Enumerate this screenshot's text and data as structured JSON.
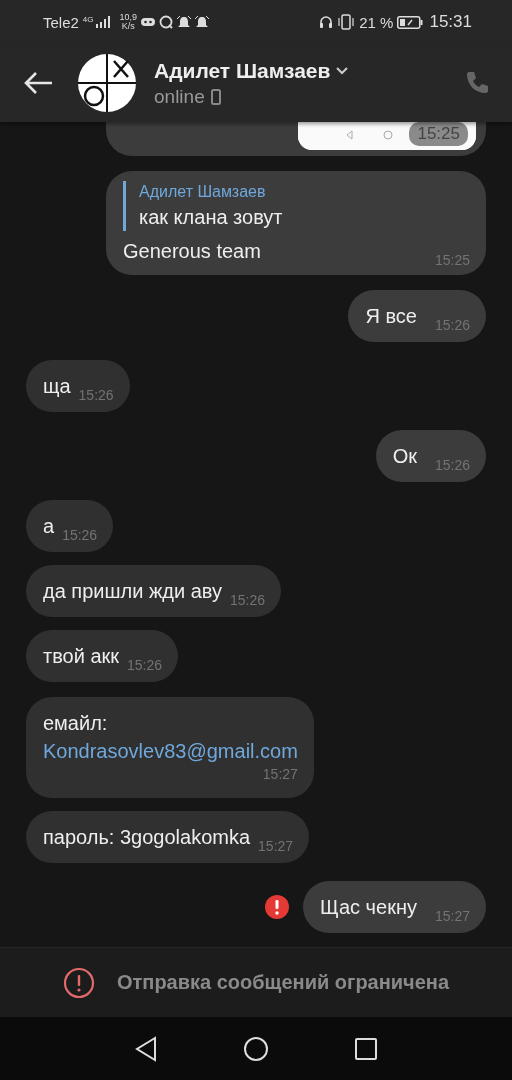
{
  "status_bar": {
    "carrier": "Tele2",
    "network": "4G",
    "speed": "10,9",
    "speed_unit": "K/s",
    "battery": "21 %",
    "time": "15:31"
  },
  "header": {
    "name": "Адилет Шамзаев",
    "status": "online"
  },
  "messages": [
    {
      "outgoing": true,
      "failed": false,
      "time": "15:25"
    },
    {
      "kind": "reply",
      "outgoing": true,
      "failed": false,
      "reply_name": "Адилет Шамзаев",
      "reply_text": "как клана зовут",
      "text": "Generous team",
      "time": "15:25"
    },
    {
      "kind": "text",
      "outgoing": true,
      "failed": false,
      "text": "Я все",
      "time": "15:26"
    },
    {
      "kind": "text",
      "outgoing": false,
      "failed": false,
      "text": "ща",
      "time": "15:26"
    },
    {
      "kind": "text",
      "outgoing": true,
      "failed": false,
      "text": "Ок",
      "time": "15:26"
    },
    {
      "kind": "text",
      "outgoing": false,
      "failed": false,
      "text": "а",
      "time": "15:26"
    },
    {
      "kind": "text",
      "outgoing": false,
      "failed": false,
      "text": "да пришли жди аву",
      "time": "15:26"
    },
    {
      "kind": "text",
      "outgoing": false,
      "failed": false,
      "text": "твой акк",
      "time": "15:26"
    },
    {
      "kind": "link",
      "outgoing": false,
      "failed": false,
      "text": "емайл:",
      "link": "Kondrasovlev83@gmail.com",
      "time": "15:27"
    },
    {
      "kind": "text",
      "outgoing": false,
      "failed": false,
      "text": "пароль: 3gogolakomka",
      "time": "15:27"
    },
    {
      "kind": "text",
      "outgoing": true,
      "failed": true,
      "text": "Щас чекну",
      "time": "15:27"
    }
  ],
  "restriction": {
    "text": "Отправка сообщений ограничена"
  }
}
